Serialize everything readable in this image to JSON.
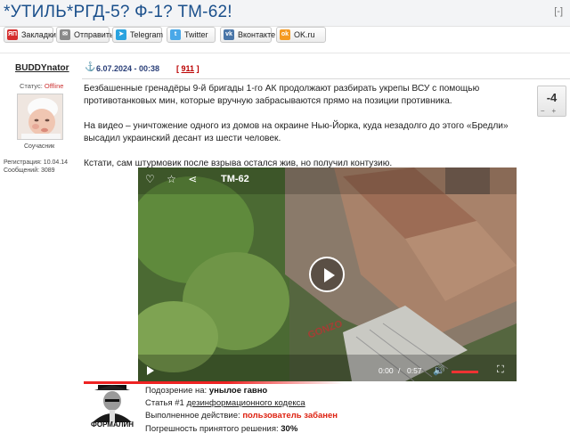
{
  "thread": {
    "title": "*УТИЛЬ*РГД-5? Ф-1? ТМ-62!",
    "tools": "[-]"
  },
  "share": [
    {
      "id": "zakladki",
      "label": "Закладки",
      "icon": "yandex-bookmarks-icon",
      "icon_text": "ЯП",
      "color": "#d52d2d"
    },
    {
      "id": "otpravit",
      "label": "Отправить",
      "icon": "mail-icon",
      "icon_text": "✉",
      "color": "#8a8a8a"
    },
    {
      "id": "telegram",
      "label": "Telegram",
      "icon": "telegram-icon",
      "icon_text": "➤",
      "color": "#2aa3df"
    },
    {
      "id": "twitter",
      "label": "Twitter",
      "icon": "twitter-icon",
      "icon_text": "t",
      "color": "#4aa8e8"
    },
    {
      "id": "vkontakte",
      "label": "Вконтакте",
      "icon": "vk-icon",
      "icon_text": "vk",
      "color": "#4a76a8"
    },
    {
      "id": "okru",
      "label": "OK.ru",
      "icon": "odnoklassniki-icon",
      "icon_text": "ok",
      "color": "#f59a22"
    }
  ],
  "post": {
    "author": "BUDDYnator",
    "date": "6.07.2024 - 00:38",
    "number_open": "[",
    "number": "911",
    "number_close": "]",
    "status_label": "Статус:",
    "status_value": "Offline",
    "rank": "Соучасник",
    "registration": "Регистрация: 10.04.14",
    "messages": "Сообщений: 3089",
    "rating": "-4",
    "paragraphs": [
      "Безбашенные гренадёры 9-й бригады 1-го АК продолжают разбирать укрепы ВСУ с помощью противотанковых мин, которые вручную забрасываются прямо на позиции противника.",
      "На видео – уничтожение одного из домов на окраине Нью-Йорка, куда незадолго до этого «Бредли» высадил украинский десант из шести человек.",
      "Кстати, сам штурмовик после взрыва остался жив, но получил контузию."
    ]
  },
  "video": {
    "title": "ТМ-62",
    "current_time": "0:00",
    "separator": "/",
    "duration": "0:57",
    "watermark": "GONZO"
  },
  "signature": {
    "label": "ФОРМАЛИН",
    "line1_label": "Подозрение на:",
    "line1_value": "унылое гавно",
    "line2_label": "Статья #1",
    "line2_value": "дезинформационного кодекса",
    "line3_label": "Выполненное действие:",
    "line3_value": "пользователь забанен",
    "line4_label": "Погрешность принятого решения:",
    "line4_value": "30%"
  }
}
